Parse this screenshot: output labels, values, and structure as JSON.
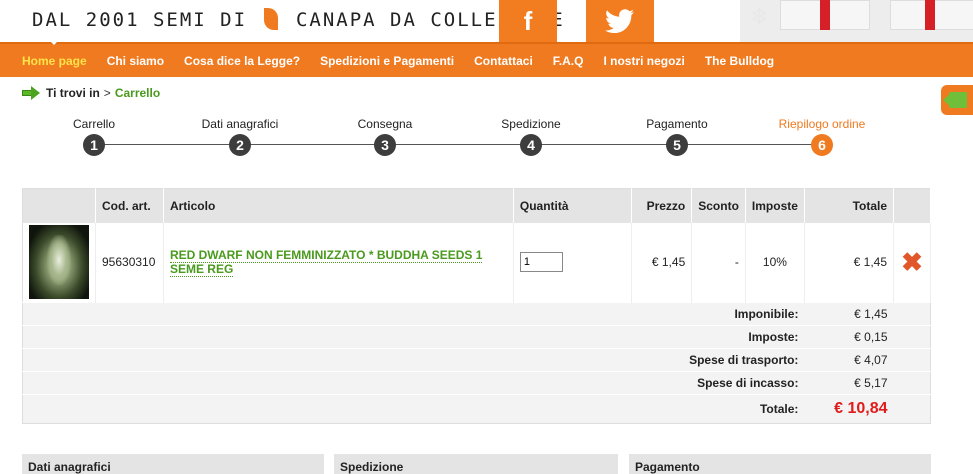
{
  "header": {
    "tagline": "DAL 2001 SEMI DI",
    "tagline_end": "CANAPA DA COLLEZIONE",
    "facebook_label": "f",
    "twitter_label": "🐦"
  },
  "nav": {
    "items": [
      {
        "label": "Home page"
      },
      {
        "label": "Chi siamo"
      },
      {
        "label": "Cosa dice la Legge?"
      },
      {
        "label": "Spedizioni e Pagamenti"
      },
      {
        "label": "Contattaci"
      },
      {
        "label": "F.A.Q"
      },
      {
        "label": "I nostri negozi"
      },
      {
        "label": "The Bulldog"
      }
    ],
    "active_index": 0
  },
  "breadcrumb": {
    "prefix": "Ti trovi in",
    "separator": ">",
    "current": "Carrello"
  },
  "steps": [
    {
      "label": "Carrello",
      "num": "1"
    },
    {
      "label": "Dati anagrafici",
      "num": "2"
    },
    {
      "label": "Consegna",
      "num": "3"
    },
    {
      "label": "Spedizione",
      "num": "4"
    },
    {
      "label": "Pagamento",
      "num": "5"
    },
    {
      "label": "Riepilogo ordine",
      "num": "6"
    }
  ],
  "current_step": 6,
  "cart": {
    "headers": {
      "code": "Cod. art.",
      "article": "Articolo",
      "quantity": "Quantità",
      "price": "Prezzo",
      "discount": "Sconto",
      "tax": "Imposte",
      "total": "Totale"
    },
    "item": {
      "code": "95630310",
      "name": "RED DWARF NON FEMMINIZZATO * BUDDHA SEEDS 1 SEME REG",
      "quantity": "1",
      "price": "€ 1,45",
      "discount": "-",
      "tax": "10%",
      "total": "€ 1,45"
    },
    "summary": [
      {
        "label": "Imponibile:",
        "value": "€ 1,45"
      },
      {
        "label": "Imposte:",
        "value": "€ 0,15"
      },
      {
        "label": "Spese di trasporto:",
        "value": "€ 4,07"
      },
      {
        "label": "Spese di incasso:",
        "value": "€ 5,17"
      }
    ],
    "grand_total": {
      "label": "Totale:",
      "value": "€ 10,84"
    }
  },
  "panels": {
    "personal": "Dati anagrafici",
    "shipping": "Spedizione",
    "payment": "Pagamento"
  },
  "colors": {
    "brand_orange": "#f07a1f",
    "link_green": "#4a9a1e",
    "total_red": "#e01b1b"
  }
}
